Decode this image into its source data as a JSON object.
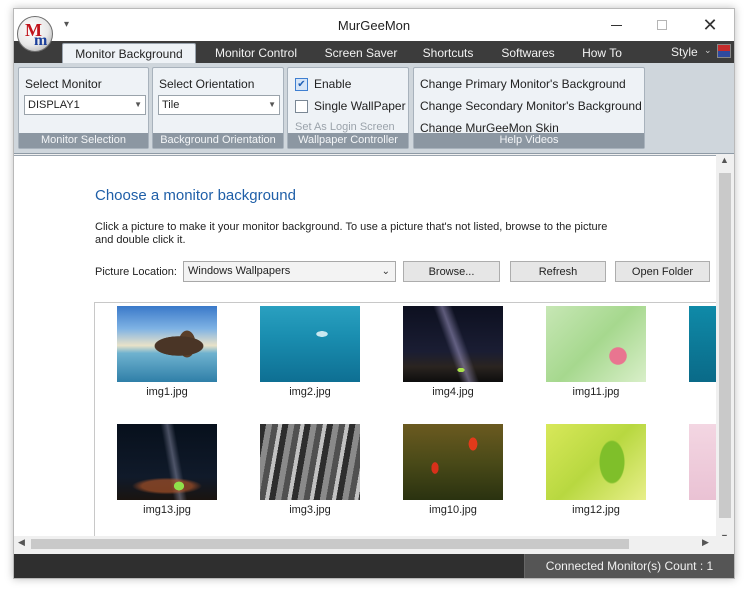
{
  "window": {
    "title": "MurGeeMon",
    "qat_glyph": "▾"
  },
  "logo": {
    "letter1": "M",
    "letter2": "m"
  },
  "tabs": [
    {
      "label": "Monitor Background",
      "active": true
    },
    {
      "label": "Monitor Control"
    },
    {
      "label": "Screen Saver"
    },
    {
      "label": "Shortcuts"
    },
    {
      "label": "Softwares"
    },
    {
      "label": "How To"
    }
  ],
  "style_menu": {
    "label": "Style",
    "arrow": "⌄"
  },
  "ribbon": {
    "monitor_selection": {
      "heading": "Select Monitor",
      "value": "DISPLAY1",
      "group_label": "Monitor Selection"
    },
    "orientation": {
      "heading": "Select Orientation",
      "value": "Tile",
      "group_label": "Background Orientation"
    },
    "controller": {
      "enable_label": "Enable",
      "enable_checked": true,
      "single_label": "Single WallPaper",
      "single_checked": false,
      "login_label": "Set As Login Screen",
      "group_label": "Wallpaper Controller"
    },
    "help": {
      "links": [
        "Change Primary Monitor's Background",
        "Change Secondary Monitor's Background",
        "Change MurGeeMon Skin"
      ],
      "group_label": "Help Videos"
    }
  },
  "main": {
    "heading": "Choose a monitor background",
    "description": "Click a picture to make it your monitor background. To use a picture that's not listed, browse to the picture and double click it.",
    "picture_location_label": "Picture Location:",
    "picture_location_value": "Windows Wallpapers",
    "browse_label": "Browse...",
    "refresh_label": "Refresh",
    "open_folder_label": "Open Folder",
    "thumbnails": [
      {
        "name": "img1.jpg"
      },
      {
        "name": "img2.jpg"
      },
      {
        "name": "img4.jpg"
      },
      {
        "name": "img11.jpg"
      },
      {
        "name": ""
      },
      {
        "name": "img13.jpg"
      },
      {
        "name": "img3.jpg"
      },
      {
        "name": "img10.jpg"
      },
      {
        "name": "img12.jpg"
      },
      {
        "name": ""
      }
    ]
  },
  "status": {
    "connected_count": "Connected Monitor(s) Count : 1"
  }
}
